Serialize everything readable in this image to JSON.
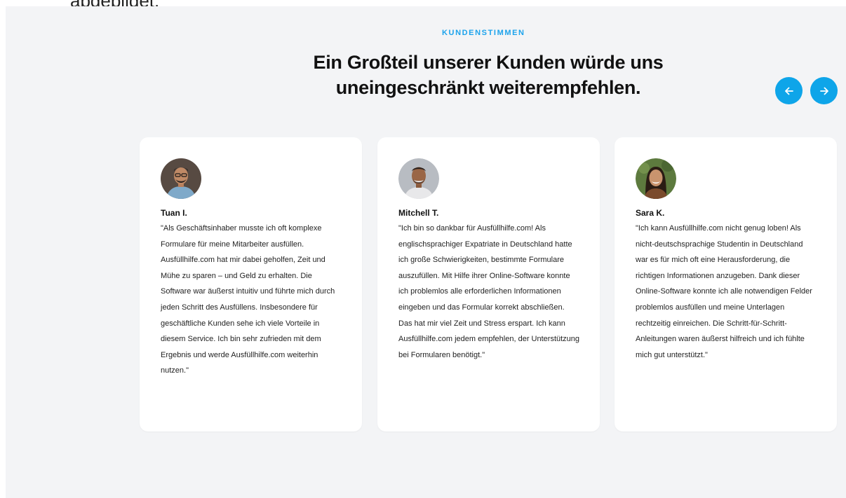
{
  "page": {
    "top_caption": "abgebildet."
  },
  "section": {
    "eyebrow": "KUNDENSTIMMEN",
    "headline": "Ein Großteil unserer Kunden würde uns uneingeschränkt weiterempfehlen.",
    "nav": {
      "prev_icon": "arrow-left-icon",
      "next_icon": "arrow-right-icon",
      "accent_color": "#0ea5e9"
    }
  },
  "testimonials": [
    {
      "name": "Tuan I.",
      "quote": "\"Als Geschäftsinhaber musste ich oft komplexe Formulare für meine Mitarbeiter ausfüllen. Ausfüllhilfe.com hat mir dabei geholfen, Zeit und Mühe zu sparen – und Geld zu erhalten. Die Software war äußerst intuitiv und führte mich durch jeden Schritt des Ausfüllens. Insbesondere für geschäftliche Kunden sehe ich viele Vorteile in diesem Service. Ich bin sehr zufrieden mit dem Ergebnis und werde Ausfüllhilfe.com weiterhin nutzen.\""
    },
    {
      "name": "Mitchell T.",
      "quote": "\"Ich bin so dankbar für Ausfüllhilfe.com! Als englischsprachiger Expatriate in Deutschland hatte ich große Schwierigkeiten, bestimmte Formulare auszufüllen. Mit Hilfe ihrer Online-Software konnte ich problemlos alle erforderlichen Informationen eingeben und das Formular korrekt abschließen. Das hat mir viel Zeit und Stress erspart. Ich kann Ausfüllhilfe.com jedem empfehlen, der Unterstützung bei Formularen benötigt.\""
    },
    {
      "name": "Sara K.",
      "quote": "\"Ich kann Ausfüllhilfe.com nicht genug loben! Als nicht-deutschsprachige Studentin in Deutschland war es für mich oft eine Herausforderung, die richtigen Informationen anzugeben. Dank dieser Online-Software konnte ich alle notwendigen Felder problemlos ausfüllen und meine Unterlagen rechtzeitig einreichen. Die Schritt-für-Schritt-Anleitungen waren äußerst hilfreich und ich fühlte mich gut unterstützt.\""
    }
  ]
}
